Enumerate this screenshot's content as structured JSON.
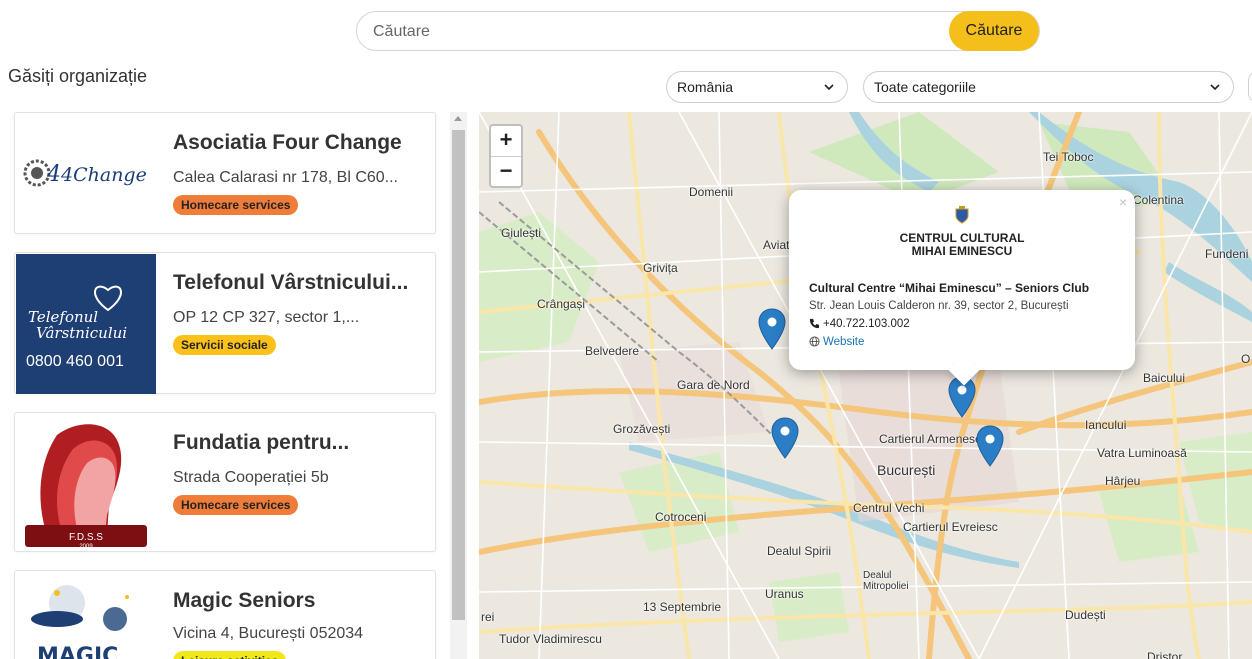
{
  "search": {
    "placeholder": "Căutare",
    "button": "Căutare"
  },
  "page_title": "Găsiți organizație",
  "filters": {
    "country": "România",
    "category": "Toate categoriile"
  },
  "cards": [
    {
      "name": "Asociatia Four Change",
      "address": "Calea Calarasi nr 178, Bl C60...",
      "badge": "Homecare services",
      "badge_color": "#f07c3a",
      "logo_text": "4Change",
      "logo_icon": "four-change-logo"
    },
    {
      "name": "Telefonul Vârstnicului...",
      "address": "OP 12 CP 327, sector 1,...",
      "badge": "Servicii sociale",
      "badge_color": "#fbc11b",
      "logo_line1": "Telefonul",
      "logo_line2": "Vârstnicului",
      "logo_phone": "0800 460 001"
    },
    {
      "name": "Fundatia pentru...",
      "address": "Strada Cooperației 5b",
      "badge": "Homecare services",
      "badge_color": "#f07c3a",
      "logo_text": "F.D.S.S",
      "logo_year": "2009"
    },
    {
      "name": "Magic Seniors",
      "address": "Vicina 4, București 052034",
      "badge": "Leisure activities",
      "badge_color": "#f0e81a",
      "logo_text": "MAGIC"
    }
  ],
  "map": {
    "zoom_in": "+",
    "zoom_out": "−",
    "labels": [
      "Giulești",
      "Crângași",
      "Grivița",
      "Domenii",
      "Aviat",
      "Belvedere",
      "Gara de Nord",
      "Grozăvești",
      "Cotroceni",
      "Dealul Spirii",
      "Uranus",
      "13 Septembrie",
      "Tudor Vladimirescu",
      "București",
      "Centrul Vechi",
      "Cartierul Evreiesc",
      "Cartierul Armenesc",
      "Iancului",
      "Vatra Luminoasă",
      "Hârjeu",
      "Dudești",
      "Baicului",
      "Colentina",
      "Fundeni",
      "Tei Toboc",
      "Dealul Mitropoliei",
      "Dristor",
      "rei",
      "O"
    ],
    "popup": {
      "org_logo_line1": "CENTRUL CULTURAL",
      "org_logo_line2": "MIHAI EMINESCU",
      "title": "Cultural Centre “Mihai Eminescu” – Seniors Club",
      "address": "Str. Jean Louis Calderon nr. 39, sector 2, București",
      "phone": "+40.722.103.002",
      "website": "Website",
      "close": "×"
    },
    "pin_color": "#2b7ec6"
  }
}
